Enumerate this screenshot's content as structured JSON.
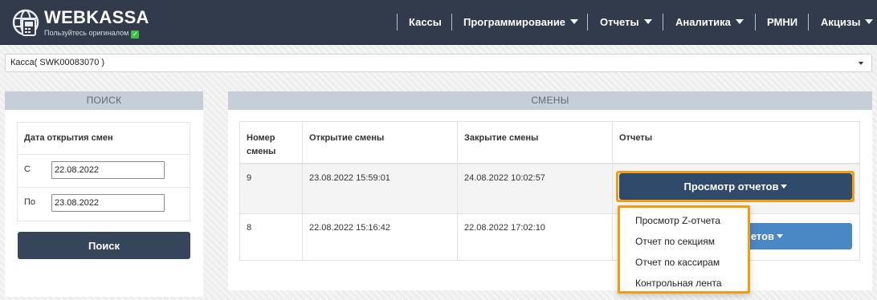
{
  "brand": {
    "title": "WEBKASSA",
    "subtitle": "Пользуйтесь оригиналом",
    "check_mark": "✓"
  },
  "nav": {
    "items": [
      {
        "label": "Кассы",
        "dropdown": false
      },
      {
        "label": "Программирование",
        "dropdown": true
      },
      {
        "label": "Отчеты",
        "dropdown": true
      },
      {
        "label": "Аналитика",
        "dropdown": true
      },
      {
        "label": "РМНИ",
        "dropdown": false
      },
      {
        "label": "Акцизы",
        "dropdown": true
      }
    ]
  },
  "kassa_select": {
    "value": "Касса( SWK00083070 )"
  },
  "search_panel": {
    "title": "ПОИСК",
    "header": "Дата открытия смен",
    "from_label": "С",
    "from_value": "22.08.2022",
    "to_label": "По",
    "to_value": "23.08.2022",
    "button": "Поиск"
  },
  "shifts_panel": {
    "title": "СМЕНЫ",
    "columns": [
      "Номер смены",
      "Открытие смены",
      "Закрытие смены",
      "Отчеты"
    ],
    "rows": [
      {
        "number": "9",
        "opened": "23.08.2022 15:59:01",
        "closed": "24.08.2022 10:02:57",
        "button": "Просмотр отчетов"
      },
      {
        "number": "8",
        "opened": "22.08.2022 15:16:42",
        "closed": "22.08.2022 17:02:10",
        "button": "Просмотр отчетов"
      }
    ],
    "partial_button_text": "четов"
  },
  "reports_dropdown": {
    "items": [
      "Просмотр Z-отчета",
      "Отчет по секциям",
      "Отчет по кассирам",
      "Контрольная лента"
    ]
  },
  "colors": {
    "navbar": "#313b4b",
    "panel_header": "#c6ced8",
    "dark_button": "#364559",
    "open_button": "#2f4a6b",
    "blue_button": "#4a87c5",
    "highlight": "#f39c12"
  }
}
